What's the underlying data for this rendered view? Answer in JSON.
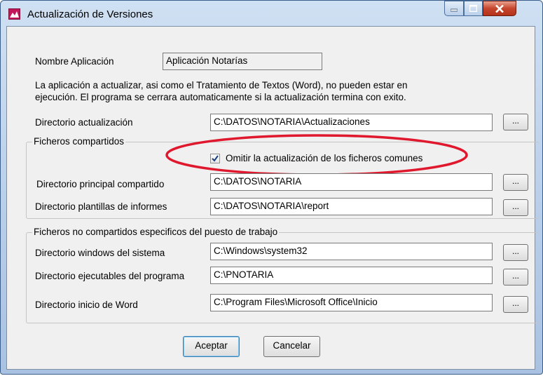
{
  "window": {
    "title": "Actualización de Versiones",
    "controls": {
      "minimize": "minimize",
      "maximize": "maximize",
      "close": "close"
    },
    "accent": "#c2185b"
  },
  "app_name": {
    "label": "Nombre Aplicación",
    "value": "Aplicación Notarías"
  },
  "notice": {
    "line1": "La aplicación a actualizar, asi como el Tratamiento de Textos (Word), no pueden estar en",
    "line2": "ejecución. El programa se cerrara automaticamente si la actualización termina con exito."
  },
  "update_dir": {
    "label": "Directorio actualización",
    "value": "C:\\DATOS\\NOTARIA\\Actualizaciones",
    "browse": "..."
  },
  "shared": {
    "title": "Ficheros compartidos",
    "skip_common": {
      "label": "Omitir la actualización de los ficheros comunes",
      "checked": true
    },
    "main_dir": {
      "label": "Directorio principal compartido",
      "value": "C:\\DATOS\\NOTARIA",
      "browse": "..."
    },
    "templates_dir": {
      "label": "Directorio plantillas de informes",
      "value": "C:\\DATOS\\NOTARIA\\report",
      "browse": "..."
    },
    "highlight_color": "#e0182d"
  },
  "local": {
    "title": "Ficheros no compartidos especificos del puesto de trabajo",
    "windows_dir": {
      "label": "Directorio windows del sistema",
      "value": "C:\\Windows\\system32",
      "browse": "..."
    },
    "exe_dir": {
      "label": "Directorio ejecutables del programa",
      "value": "C:\\PNOTARIA",
      "browse": "..."
    },
    "word_dir": {
      "label": "Directorio inicio de Word",
      "value": "C:\\Program Files\\Microsoft Office\\Inicio",
      "browse": "..."
    }
  },
  "buttons": {
    "accept": "Aceptar",
    "cancel": "Cancelar"
  }
}
